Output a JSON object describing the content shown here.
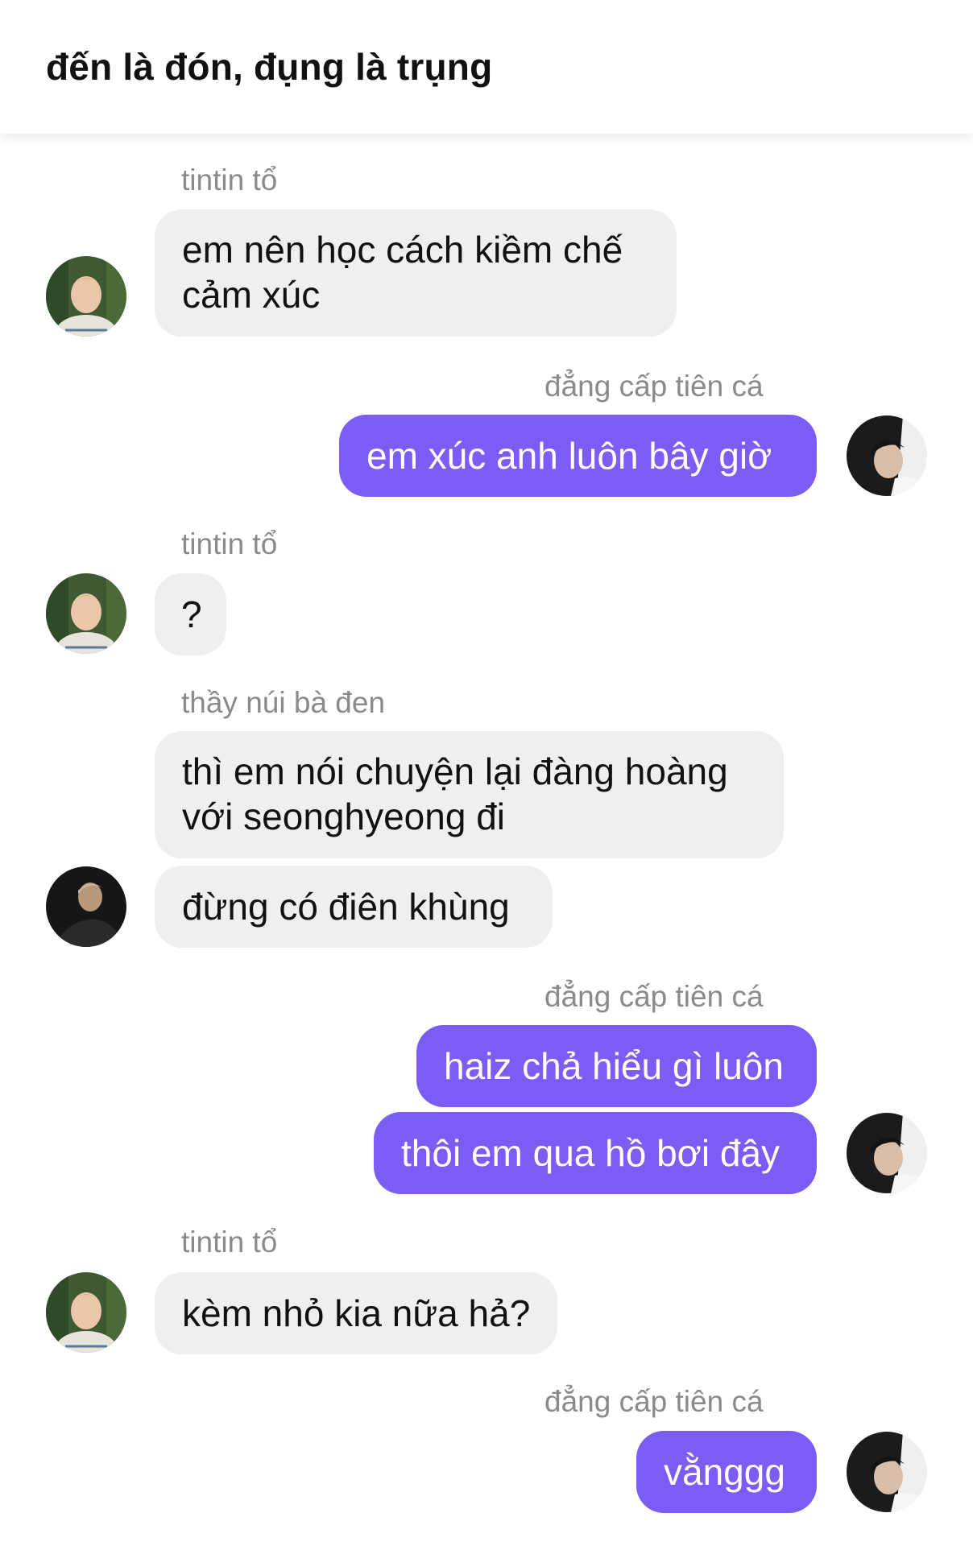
{
  "header": {
    "title": "đến là đón, đụng là trụng"
  },
  "colors": {
    "accent": "#7b5cf5",
    "incoming_bubble": "#efeff2",
    "sender_text": "#8a8a8e"
  },
  "messages": [
    {
      "sender": "tintin tổ",
      "direction": "in",
      "lines": [
        "em nên học cách kiềm chế",
        "cảm xúc"
      ]
    },
    {
      "sender": "đẳng cấp tiên cá",
      "direction": "out",
      "lines": [
        "em xúc anh luôn bây giờ"
      ]
    },
    {
      "sender": "tintin tổ",
      "direction": "in",
      "lines": [
        "?"
      ]
    },
    {
      "sender": "thầy núi bà đen",
      "direction": "in",
      "lines": [
        "thì em nói chuyện lại đàng hoàng",
        "với seonghyeong đi"
      ]
    },
    {
      "sender": "",
      "direction": "in",
      "lines": [
        "đừng có điên khùng"
      ]
    },
    {
      "sender": "đẳng cấp tiên cá",
      "direction": "out",
      "lines": [
        "haiz chả hiểu gì luôn"
      ]
    },
    {
      "sender": "",
      "direction": "out",
      "lines": [
        "thôi em qua hồ bơi đây"
      ]
    },
    {
      "sender": "tintin tổ",
      "direction": "in",
      "lines": [
        "kèm nhỏ kia nữa hả?"
      ]
    },
    {
      "sender": "đẳng cấp tiên cá",
      "direction": "out",
      "lines": [
        "vằnggg"
      ]
    }
  ]
}
